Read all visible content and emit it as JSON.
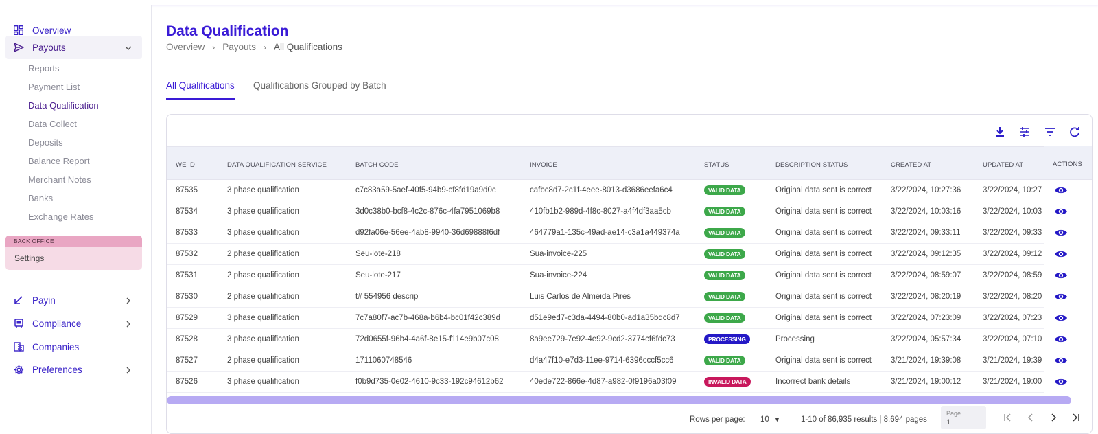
{
  "sidebar": {
    "overview": "Overview",
    "payouts": "Payouts",
    "payouts_items": [
      "Reports",
      "Payment List",
      "Data Qualification",
      "Data Collect",
      "Deposits",
      "Balance Report",
      "Merchant Notes",
      "Banks",
      "Exchange Rates"
    ],
    "backoffice_header": "BACK OFFICE",
    "backoffice_item": "Settings",
    "payin": "Payin",
    "compliance": "Compliance",
    "companies": "Companies",
    "preferences": "Preferences"
  },
  "header": {
    "title": "Data Qualification",
    "breadcrumb": [
      "Overview",
      "Payouts",
      "All Qualifications"
    ]
  },
  "tabs": [
    "All Qualifications",
    "Qualifications Grouped by Batch"
  ],
  "table": {
    "columns": [
      "WE ID",
      "DATA QUALIFICATION SERVICE",
      "BATCH CODE",
      "INVOICE",
      "STATUS",
      "DESCRIPTION STATUS",
      "CREATED AT",
      "UPDATED AT",
      "ACTIONS"
    ],
    "rows": [
      {
        "id": "87535",
        "service": "3 phase qualification",
        "batch": "c7c83a59-5aef-40f5-94b9-cf8fd19a9d0c",
        "invoice": "cafbc8d7-2c1f-4eee-8013-d3686eefa6c4",
        "status": "VALID DATA",
        "desc": "Original data sent is correct",
        "created": "3/22/2024, 10:27:36",
        "updated": "3/22/2024, 10:27"
      },
      {
        "id": "87534",
        "service": "3 phase qualification",
        "batch": "3d0c38b0-bcf8-4c2c-876c-4fa7951069b8",
        "invoice": "410fb1b2-989d-4f8c-8027-a4f4df3aa5cb",
        "status": "VALID DATA",
        "desc": "Original data sent is correct",
        "created": "3/22/2024, 10:03:16",
        "updated": "3/22/2024, 10:03"
      },
      {
        "id": "87533",
        "service": "3 phase qualification",
        "batch": "d92fa06e-56ee-4ab8-9940-36d69888f6df",
        "invoice": "464779a1-135c-49ad-ae14-c3a1a449374a",
        "status": "VALID DATA",
        "desc": "Original data sent is correct",
        "created": "3/22/2024, 09:33:11",
        "updated": "3/22/2024, 09:33"
      },
      {
        "id": "87532",
        "service": "2 phase qualification",
        "batch": "Seu-lote-218",
        "invoice": "Sua-invoice-225",
        "status": "VALID DATA",
        "desc": "Original data sent is correct",
        "created": "3/22/2024, 09:12:35",
        "updated": "3/22/2024, 09:12"
      },
      {
        "id": "87531",
        "service": "2 phase qualification",
        "batch": "Seu-lote-217",
        "invoice": "Sua-invoice-224",
        "status": "VALID DATA",
        "desc": "Original data sent is correct",
        "created": "3/22/2024, 08:59:07",
        "updated": "3/22/2024, 08:59"
      },
      {
        "id": "87530",
        "service": "2 phase qualification",
        "batch": "t# 554956 descrip",
        "invoice": "Luis Carlos de Almeida Pires",
        "status": "VALID DATA",
        "desc": "Original data sent is correct",
        "created": "3/22/2024, 08:20:19",
        "updated": "3/22/2024, 08:20"
      },
      {
        "id": "87529",
        "service": "3 phase qualification",
        "batch": "7c7a80f7-ac7b-468a-b6b4-bc01f42c389d",
        "invoice": "d51e9ed7-c3da-4494-80b0-ad1a35bdc8d7",
        "status": "VALID DATA",
        "desc": "Original data sent is correct",
        "created": "3/22/2024, 07:23:09",
        "updated": "3/22/2024, 07:23"
      },
      {
        "id": "87528",
        "service": "3 phase qualification",
        "batch": "72d0655f-96b4-4a6f-8e15-f114e9b07c08",
        "invoice": "8a9ee729-7e92-4e92-9cd2-3774cf6fdc73",
        "status": "PROCESSING",
        "desc": "Processing",
        "created": "3/22/2024, 05:57:34",
        "updated": "3/22/2024, 07:10"
      },
      {
        "id": "87527",
        "service": "2 phase qualification",
        "batch": "1711060748546",
        "invoice": "d4a47f10-e7d3-11ee-9714-6396cccf5cc6",
        "status": "VALID DATA",
        "desc": "Original data sent is correct",
        "created": "3/21/2024, 19:39:08",
        "updated": "3/21/2024, 19:39"
      },
      {
        "id": "87526",
        "service": "3 phase qualification",
        "batch": "f0b9d735-0e02-4610-9c33-192c94612b62",
        "invoice": "40ede722-866e-4d87-a982-0f9196a03f09",
        "status": "INVALID DATA",
        "desc": "Incorrect bank details",
        "created": "3/21/2024, 19:00:12",
        "updated": "3/21/2024, 19:00"
      }
    ]
  },
  "status_colors": {
    "VALID DATA": "#3da84a",
    "PROCESSING": "#2418c6",
    "INVALID DATA": "#c8185c"
  },
  "pagination": {
    "rows_per_page_label": "Rows per page:",
    "rows_per_page": "10",
    "results": "1-10 of 86,935 results | 8,694 pages",
    "page_caption": "Page",
    "page_value": "1"
  },
  "accent": "#3a1bd6",
  "icons": [
    "dashboard-icon",
    "send-icon",
    "payin-arrow-icon",
    "compliance-icon",
    "companies-icon",
    "gear-icon",
    "download-icon",
    "tune-icon",
    "filter-icon",
    "refresh-icon",
    "eye-icon",
    "first-page-icon",
    "prev-page-icon",
    "next-page-icon",
    "last-page-icon"
  ]
}
